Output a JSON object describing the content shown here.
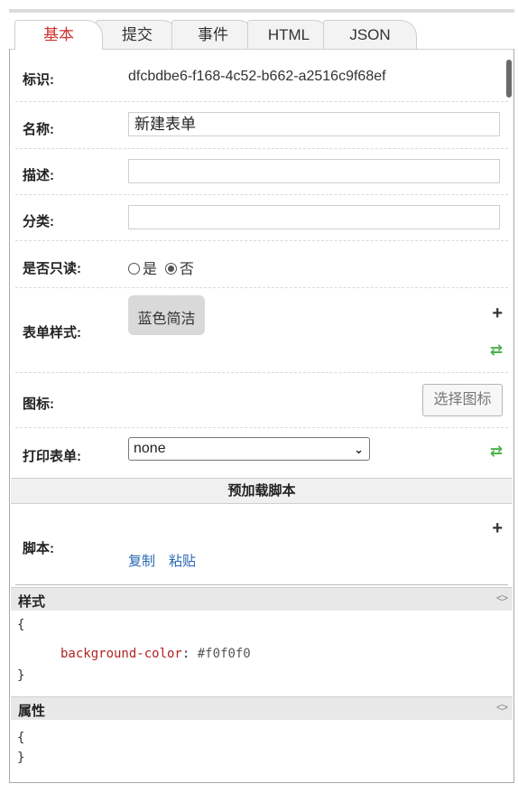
{
  "tabs": [
    "基本",
    "提交",
    "事件",
    "HTML",
    "JSON"
  ],
  "fields": {
    "id_label": "标识:",
    "id_value": "dfcbdbe6-f168-4c52-b662-a2516c9f68ef",
    "name_label": "名称:",
    "name_value": "新建表单",
    "desc_label": "描述:",
    "desc_value": "",
    "category_label": "分类:",
    "category_value": "",
    "readonly_label": "是否只读:",
    "readonly_yes": "是",
    "readonly_no": "否",
    "readonly_selected": "否",
    "style_label": "表单样式:",
    "style_value": "蓝色简洁",
    "icon_label": "图标:",
    "choose_icon": "选择图标",
    "print_label": "打印表单:",
    "print_value": "none"
  },
  "preload": {
    "section_title": "预加载脚本",
    "script_label": "脚本:",
    "copy": "复制",
    "paste": "粘贴"
  },
  "style_editor": {
    "title": "样式",
    "open": "{",
    "property": "background-color",
    "colon": ":",
    "value": "#f0f0f0",
    "close": "}"
  },
  "attr_editor": {
    "title": "属性",
    "open": "{",
    "close": "}"
  },
  "icons": {
    "add": "plus-icon",
    "refresh": "refresh-icon",
    "code": "code-toggle-icon",
    "dropdown": "chevron-down-icon"
  },
  "colors": {
    "active_tab": "#d0312d",
    "link": "#2867b2",
    "refresh": "#4bb04b",
    "css_property": "#b22222"
  }
}
